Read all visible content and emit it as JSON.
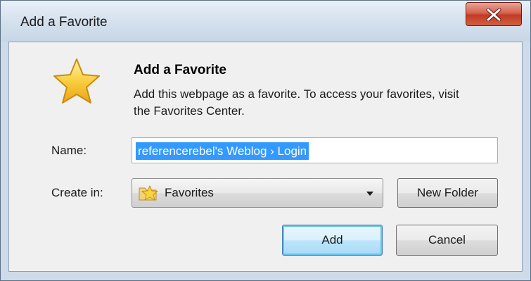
{
  "window": {
    "title": "Add a Favorite"
  },
  "header": {
    "heading": "Add a Favorite",
    "description": "Add this webpage as a favorite. To access your favorites, visit the Favorites Center.",
    "icon": "star-icon"
  },
  "form": {
    "name_label": "Name:",
    "name_value": "referencerebel's Weblog › Login",
    "create_in_label": "Create in:",
    "create_in_value": "Favorites",
    "create_in_icon": "folder-star-icon"
  },
  "buttons": {
    "new_folder": "New Folder",
    "add": "Add",
    "cancel": "Cancel"
  },
  "colors": {
    "selection": "#3399ff",
    "close_button": "#c8412c",
    "star": "#f7c531"
  }
}
